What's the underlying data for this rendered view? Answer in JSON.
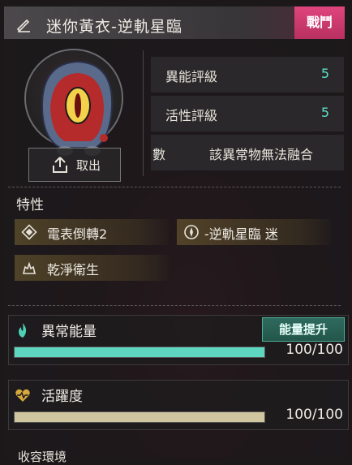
{
  "header": {
    "title": "迷你黃衣-逆軌星臨",
    "mode_badge": "戰鬥"
  },
  "portrait": {
    "remove_label": "取出"
  },
  "stats": [
    {
      "label": "異能評級",
      "value": "5"
    },
    {
      "label": "活性評級",
      "value": "5"
    },
    {
      "label": "數",
      "text": "該異常物無法融合"
    }
  ],
  "traits": {
    "title": "特性",
    "items": [
      {
        "label": "電表倒轉2",
        "icon": "diamond-icon"
      },
      {
        "label": "-逆軌星臨 迷",
        "icon": "compass-icon"
      },
      {
        "label": "乾淨衛生",
        "icon": "hand-icon"
      }
    ]
  },
  "energy": {
    "label": "異常能量",
    "value": "100/100",
    "fill": 1.0,
    "boost_label": "能量提升",
    "color": "#5fd6bf"
  },
  "activity": {
    "label": "活躍度",
    "value": "100/100",
    "fill": 1.0,
    "color": "#cfc6a0"
  },
  "footer_hint": "收容環境"
}
